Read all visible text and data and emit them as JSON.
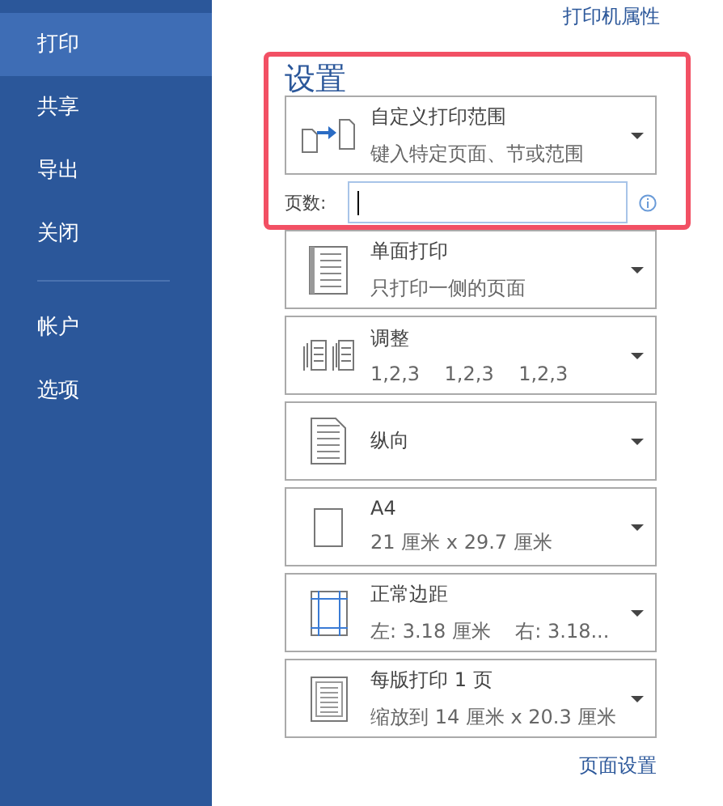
{
  "sidebar": {
    "groups": [
      [
        {
          "label": "打印",
          "selected": true
        },
        {
          "label": "共享",
          "selected": false
        },
        {
          "label": "导出",
          "selected": false
        },
        {
          "label": "关闭",
          "selected": false
        }
      ],
      [
        {
          "label": "帐户",
          "selected": false
        },
        {
          "label": "选项",
          "selected": false
        }
      ]
    ]
  },
  "printer_properties_link": "打印机属性",
  "settings": {
    "heading": "设置",
    "highlight": true,
    "options": [
      {
        "kind": "range",
        "title": "自定义打印范围",
        "subtitle": "键入特定页面、节或范围"
      },
      {
        "kind": "pages-field",
        "label": "页数:",
        "info": true
      },
      {
        "kind": "sides",
        "title": "单面打印",
        "subtitle": "只打印一侧的页面"
      },
      {
        "kind": "collate",
        "title": "调整",
        "subtitle": "1,2,3    1,2,3    1,2,3"
      },
      {
        "kind": "orientation",
        "title": "纵向"
      },
      {
        "kind": "paper",
        "title": "A4",
        "subtitle": "21 厘米 x 29.7 厘米"
      },
      {
        "kind": "margins",
        "title": "正常边距",
        "subtitle": "左: 3.18 厘米    右: 3.18..."
      },
      {
        "kind": "per-sheet",
        "title": "每版打印 1 页",
        "subtitle": "缩放到 14 厘米 x 20.3 厘米"
      }
    ]
  },
  "page_setup_link": "页面设置"
}
